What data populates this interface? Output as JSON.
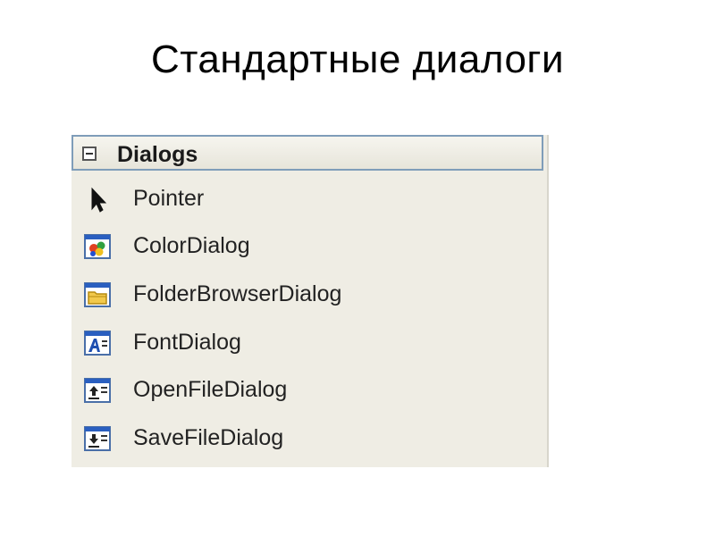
{
  "slide": {
    "title": "Стандартные диалоги"
  },
  "toolbox": {
    "group_title": "Dialogs",
    "items": [
      {
        "label": "Pointer",
        "icon": "pointer-icon"
      },
      {
        "label": "ColorDialog",
        "icon": "color-dialog-icon"
      },
      {
        "label": "FolderBrowserDialog",
        "icon": "folder-browser-dialog-icon"
      },
      {
        "label": "FontDialog",
        "icon": "font-dialog-icon"
      },
      {
        "label": "OpenFileDialog",
        "icon": "open-file-dialog-icon"
      },
      {
        "label": "SaveFileDialog",
        "icon": "save-file-dialog-icon"
      }
    ]
  },
  "colors": {
    "panel_background": "#efede4",
    "header_border": "#7f9db9",
    "icon_blue": "#2a5fc0"
  }
}
